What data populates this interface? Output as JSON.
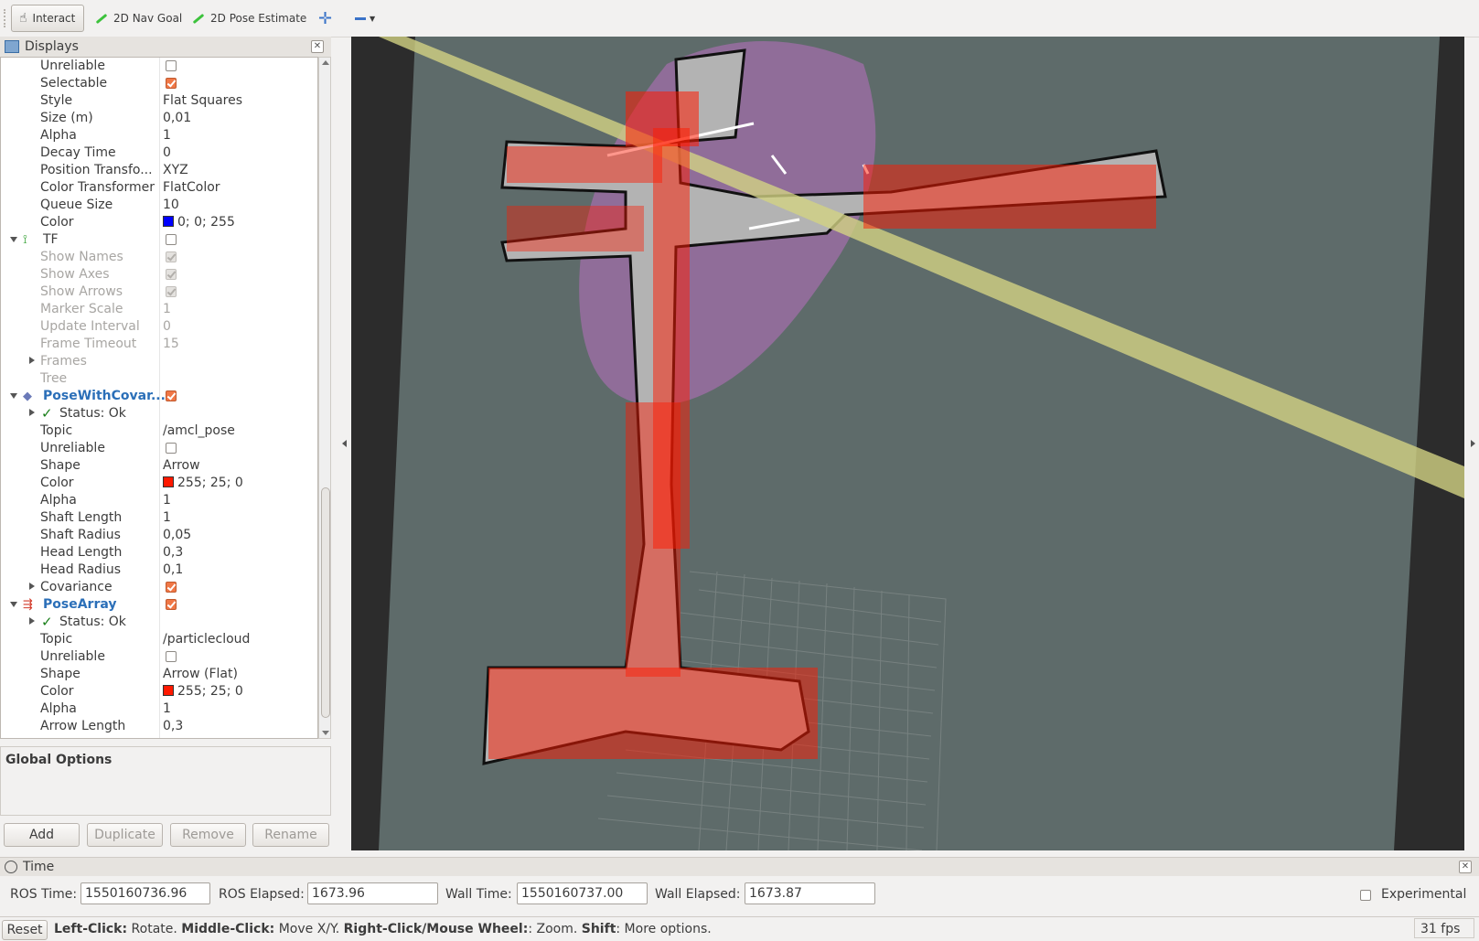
{
  "toolbar": {
    "interact": "Interact",
    "nav_goal": "2D Nav Goal",
    "pose_estimate": "2D Pose Estimate"
  },
  "displays": {
    "title": "Displays",
    "rows": [
      {
        "name": "Unreliable",
        "value": "",
        "checkbox": "off"
      },
      {
        "name": "Selectable",
        "value": "",
        "checkbox": "on"
      },
      {
        "name": "Style",
        "value": "Flat Squares"
      },
      {
        "name": "Size (m)",
        "value": "0,01"
      },
      {
        "name": "Alpha",
        "value": "1"
      },
      {
        "name": "Decay Time",
        "value": "0"
      },
      {
        "name": "Position Transfo...",
        "value": "XYZ"
      },
      {
        "name": "Color Transformer",
        "value": "FlatColor"
      },
      {
        "name": "Queue Size",
        "value": "10"
      },
      {
        "name": "Color",
        "value": "0; 0; 255",
        "swatch": "#0000ff"
      },
      {
        "name": "TF",
        "value": "",
        "checkbox": "off",
        "level": 0,
        "expand": "down",
        "icon": "tf"
      },
      {
        "name": "Show Names",
        "value": "",
        "checkbox": "gray",
        "disabled": true
      },
      {
        "name": "Show Axes",
        "value": "",
        "checkbox": "gray",
        "disabled": true
      },
      {
        "name": "Show Arrows",
        "value": "",
        "checkbox": "gray",
        "disabled": true
      },
      {
        "name": "Marker Scale",
        "value": "1",
        "disabled": true
      },
      {
        "name": "Update Interval",
        "value": "0",
        "disabled": true
      },
      {
        "name": "Frame Timeout",
        "value": "15",
        "disabled": true
      },
      {
        "name": "Frames",
        "value": "",
        "disabled": true,
        "expand": "right"
      },
      {
        "name": "Tree",
        "value": "",
        "disabled": true
      },
      {
        "name": "PoseWithCovar...",
        "value": "",
        "checkbox": "on",
        "level": 0,
        "expand": "down",
        "icon": "pose",
        "selected": true
      },
      {
        "name": "Status: Ok",
        "value": "",
        "expand": "right",
        "status": true
      },
      {
        "name": "Topic",
        "value": "/amcl_pose"
      },
      {
        "name": "Unreliable",
        "value": "",
        "checkbox": "off"
      },
      {
        "name": "Shape",
        "value": "Arrow"
      },
      {
        "name": "Color",
        "value": "255; 25; 0",
        "swatch": "#ff1900"
      },
      {
        "name": "Alpha",
        "value": "1"
      },
      {
        "name": "Shaft Length",
        "value": "1"
      },
      {
        "name": "Shaft Radius",
        "value": "0,05"
      },
      {
        "name": "Head Length",
        "value": "0,3"
      },
      {
        "name": "Head Radius",
        "value": "0,1"
      },
      {
        "name": "Covariance",
        "value": "",
        "checkbox": "on",
        "expand": "right"
      },
      {
        "name": "PoseArray",
        "value": "",
        "checkbox": "on",
        "level": 0,
        "expand": "down",
        "icon": "posearray",
        "selected": true
      },
      {
        "name": "Status: Ok",
        "value": "",
        "expand": "right",
        "status": true
      },
      {
        "name": "Topic",
        "value": "/particlecloud"
      },
      {
        "name": "Unreliable",
        "value": "",
        "checkbox": "off"
      },
      {
        "name": "Shape",
        "value": "Arrow (Flat)"
      },
      {
        "name": "Color",
        "value": "255; 25; 0",
        "swatch": "#ff1900"
      },
      {
        "name": "Alpha",
        "value": "1"
      },
      {
        "name": "Arrow Length",
        "value": "0,3"
      }
    ]
  },
  "global_options": "Global Options",
  "buttons": {
    "add": "Add",
    "duplicate": "Duplicate",
    "remove": "Remove",
    "rename": "Rename"
  },
  "time": {
    "title": "Time",
    "ros_time_label": "ROS Time:",
    "ros_time": "1550160736.96",
    "ros_elapsed_label": "ROS Elapsed:",
    "ros_elapsed": "1673.96",
    "wall_time_label": "Wall Time:",
    "wall_time": "1550160737.00",
    "wall_elapsed_label": "Wall Elapsed:",
    "wall_elapsed": "1673.87",
    "experimental": "Experimental"
  },
  "status": {
    "reset": "Reset",
    "k1": "Left-Click:",
    "t1": " Rotate. ",
    "k2": "Middle-Click:",
    "t2": " Move X/Y. ",
    "k3": "Right-Click/Mouse Wheel:",
    "t3": ": Zoom. ",
    "k4": "Shift",
    "t4": ": More options.",
    "fps": "31 fps"
  },
  "colors": {
    "particle": "#ff1900",
    "map_free": "#b3b3b3",
    "map_unknown": "#5e6b6a",
    "covariance": "#b96fc0",
    "laser_band": "#d2d283",
    "selected_text": "#2b6fb8",
    "checkbox_on": "#f07746"
  }
}
